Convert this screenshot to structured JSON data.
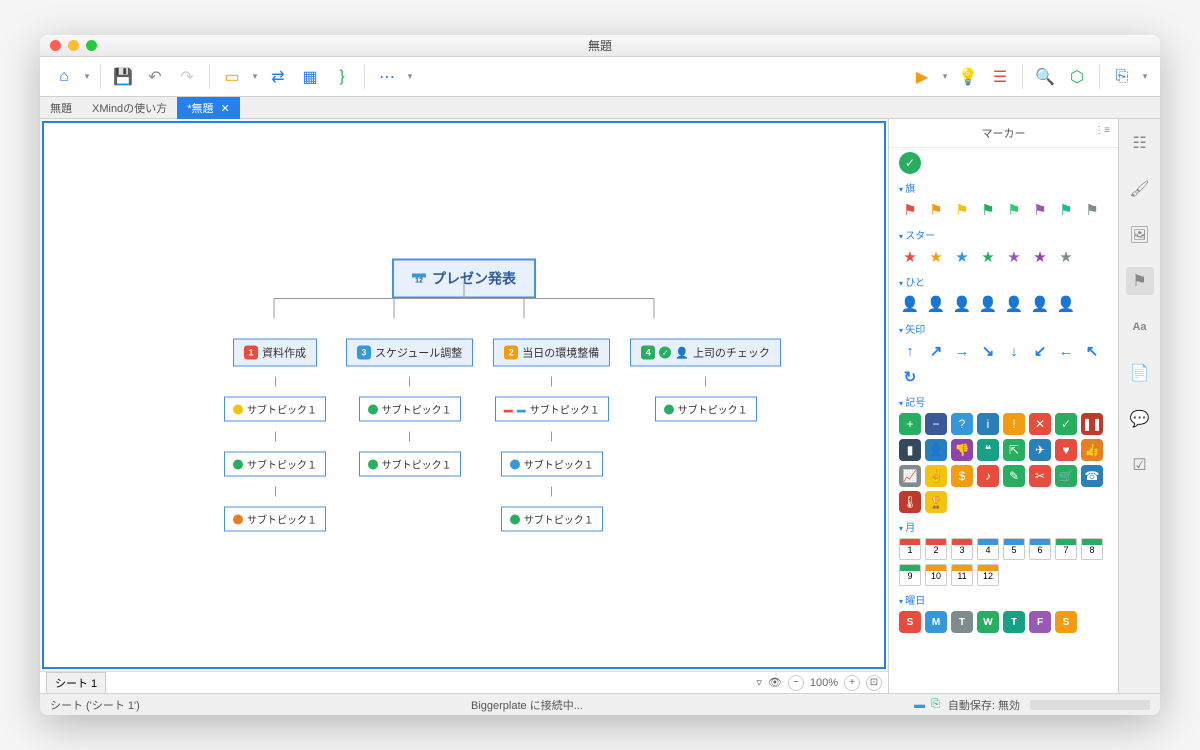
{
  "window": {
    "title": "無題"
  },
  "tabs": [
    {
      "label": "無題",
      "active": false
    },
    {
      "label": "XMindの使い方",
      "active": false
    },
    {
      "label": "*無題",
      "active": true
    }
  ],
  "mindmap": {
    "root": "プレゼン発表",
    "branches": [
      {
        "num": "1",
        "numColor": "bg-red",
        "label": "資料作成",
        "subs": [
          "サブトピック１",
          "サブトピック１",
          "サブトピック１"
        ]
      },
      {
        "num": "3",
        "numColor": "bg-blue",
        "label": "スケジュール調整",
        "subs": [
          "サブトピック１",
          "サブトピック１"
        ]
      },
      {
        "num": "2",
        "numColor": "bg-orange",
        "label": "当日の環境整備",
        "subs": [
          "サブトピック１",
          "サブトピック１",
          "サブトピック１"
        ]
      },
      {
        "num": "4",
        "numColor": "bg-green",
        "label": "上司のチェック",
        "subs": [
          "サブトピック１"
        ]
      }
    ]
  },
  "sheet": {
    "tab": "シート 1"
  },
  "zoom": {
    "value": "100%"
  },
  "markers": {
    "title": "マーカー",
    "sections": {
      "flags": "旗",
      "stars": "スター",
      "people": "ひと",
      "arrows": "矢印",
      "symbols": "記号",
      "months": "月",
      "days": "曜日"
    },
    "flag_colors": [
      "#e74c3c",
      "#f39c12",
      "#f1c40f",
      "#27ae60",
      "#2ecc71",
      "#9b59b6",
      "#1abc9c",
      "#7f8c8d"
    ],
    "star_colors": [
      "#e74c3c",
      "#f39c12",
      "#3498db",
      "#27ae60",
      "#9b59b6",
      "#8e44ad",
      "#7f8c8d"
    ],
    "people_colors": [
      "#e74c3c",
      "#f39c12",
      "#f1c40f",
      "#27ae60",
      "#3498db",
      "#16a085",
      "#7f8c8d"
    ],
    "arrow_colors": [
      "#2680eb",
      "#2680eb",
      "#2680eb",
      "#2680eb",
      "#2680eb",
      "#2680eb",
      "#2680eb",
      "#2680eb"
    ],
    "arrow_glyphs": [
      "↑",
      "↗",
      "→",
      "↘",
      "↓",
      "↙",
      "←",
      "↖",
      "↻"
    ],
    "symbol_boxes": [
      {
        "bg": "#27ae60",
        "g": "+"
      },
      {
        "bg": "#3b5998",
        "g": "−"
      },
      {
        "bg": "#3498db",
        "g": "?"
      },
      {
        "bg": "#2980b9",
        "g": "i"
      },
      {
        "bg": "#f39c12",
        "g": "!"
      },
      {
        "bg": "#e74c3c",
        "g": "✕"
      },
      {
        "bg": "#27ae60",
        "g": "✓"
      },
      {
        "bg": "#c0392b",
        "g": "❚❚"
      },
      {
        "bg": "#34495e",
        "g": "▮"
      },
      {
        "bg": "#2980b9",
        "g": "👤"
      },
      {
        "bg": "#8e44ad",
        "g": "👎"
      },
      {
        "bg": "#16a085",
        "g": "❝"
      },
      {
        "bg": "#27ae60",
        "g": "⇱"
      },
      {
        "bg": "#2980b9",
        "g": "✈"
      },
      {
        "bg": "#e74c3c",
        "g": "♥"
      },
      {
        "bg": "#e67e22",
        "g": "👍"
      },
      {
        "bg": "#7f8c8d",
        "g": "📈"
      },
      {
        "bg": "#f1c40f",
        "g": "✌"
      },
      {
        "bg": "#f39c12",
        "g": "$"
      },
      {
        "bg": "#e74c3c",
        "g": "♪"
      },
      {
        "bg": "#27ae60",
        "g": "✎"
      },
      {
        "bg": "#e74c3c",
        "g": "✂"
      },
      {
        "bg": "#27ae60",
        "g": "🛒"
      },
      {
        "bg": "#2980b9",
        "g": "☎"
      },
      {
        "bg": "#c0392b",
        "g": "🌡"
      },
      {
        "bg": "#f1c40f",
        "g": "🏆"
      }
    ],
    "month_colors": [
      "#e74c3c",
      "#e74c3c",
      "#e74c3c",
      "#3498db",
      "#3498db",
      "#3498db",
      "#27ae60",
      "#27ae60",
      "#27ae60",
      "#f39c12",
      "#f39c12",
      "#f39c12"
    ],
    "month_labels": [
      "1",
      "2",
      "3",
      "4",
      "5",
      "6",
      "7",
      "8",
      "9",
      "10",
      "11",
      "12"
    ],
    "day_boxes": [
      {
        "bg": "#e74c3c",
        "g": "S"
      },
      {
        "bg": "#3498db",
        "g": "M"
      },
      {
        "bg": "#7f8c8d",
        "g": "T"
      },
      {
        "bg": "#27ae60",
        "g": "W"
      },
      {
        "bg": "#16a085",
        "g": "T"
      },
      {
        "bg": "#9b59b6",
        "g": "F"
      },
      {
        "bg": "#f39c12",
        "g": "S"
      }
    ]
  },
  "status": {
    "left": "シート ('シート 1')",
    "center": "Biggerplate に接続中...",
    "right": "自動保存: 無効"
  }
}
